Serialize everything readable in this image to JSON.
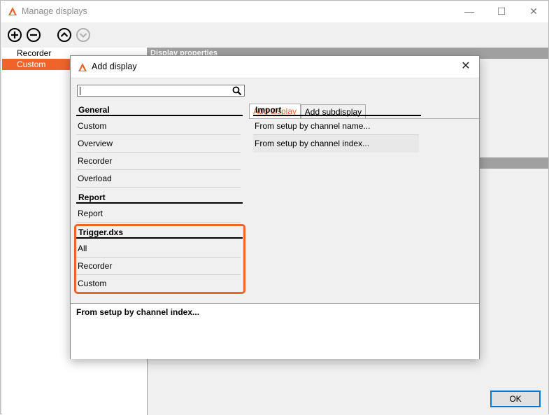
{
  "window": {
    "title": "Manage displays",
    "controls": {
      "minimize": "—",
      "maximize": "☐",
      "close": "✕"
    }
  },
  "toolbar": {
    "icons": [
      "add-icon",
      "remove-icon",
      "move-up-icon",
      "move-down-icon"
    ]
  },
  "left_list": {
    "items": [
      {
        "label": "Recorder",
        "selected": false
      },
      {
        "label": "Custom",
        "selected": true
      }
    ]
  },
  "right_panel": {
    "header": "Display properties"
  },
  "ok_button": "OK",
  "dialog": {
    "title": "Add display",
    "close": "✕",
    "search": {
      "value": "",
      "placeholder": ""
    },
    "tabs": [
      {
        "label": "Add display",
        "active": true
      },
      {
        "label": "Add subdisplay",
        "active": false
      }
    ],
    "groups": [
      {
        "title": "General",
        "items": [
          "Custom",
          "Overview",
          "Recorder",
          "Overload"
        ]
      },
      {
        "title": "Report",
        "items": [
          "Report"
        ]
      },
      {
        "title": "Trigger.dxs",
        "items": [
          "All",
          "Recorder",
          "Custom"
        ]
      }
    ],
    "import": {
      "title": "Import",
      "items": [
        "From setup by channel name...",
        "From setup by channel index..."
      ]
    },
    "description": "From setup by channel index..."
  },
  "colors": {
    "accent": "#f0642c",
    "header_gray": "#a0a0a0",
    "ok_border": "#0078d7"
  }
}
